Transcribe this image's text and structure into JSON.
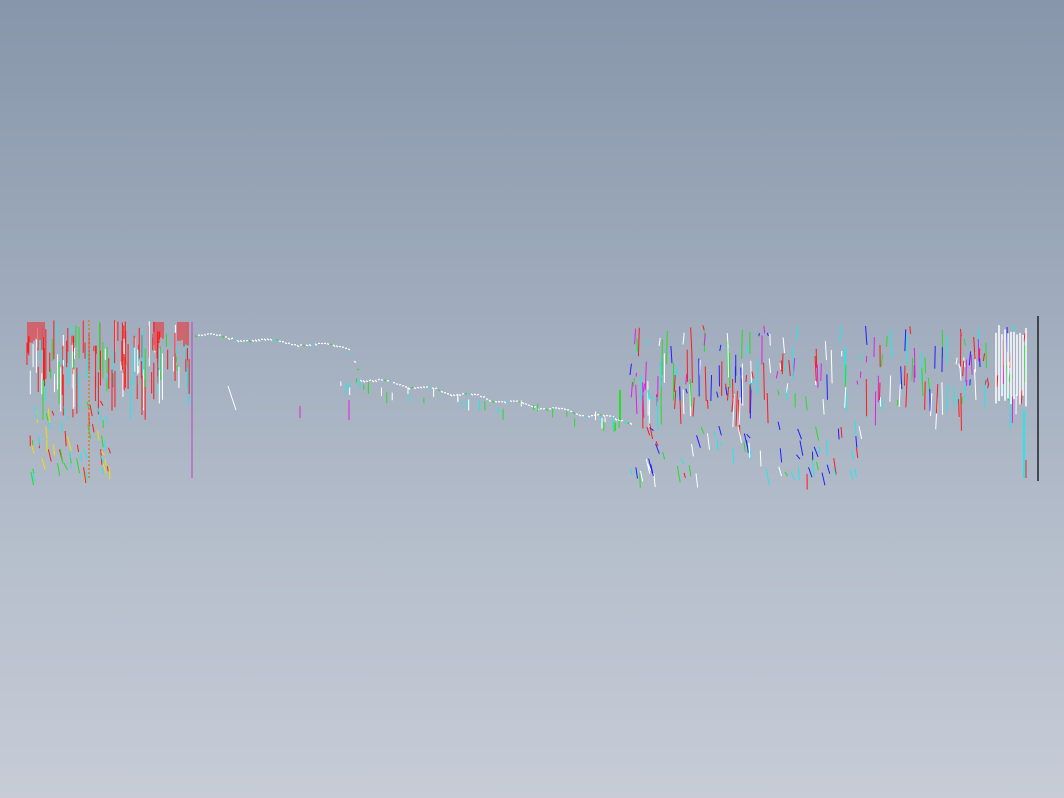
{
  "viewport": {
    "background_top": "#8796aa",
    "background_bottom": "#c7ccd7"
  },
  "palette": {
    "red": "#ff1a1a",
    "green": "#22e022",
    "cyan": "#22e8e8",
    "white": "#ffffff",
    "magenta": "#e020e0",
    "blue": "#2020ff",
    "yellow": "#f0e000",
    "black": "#000000",
    "orange": "#e07a20"
  },
  "drawing": {
    "description_visible_text": ""
  }
}
